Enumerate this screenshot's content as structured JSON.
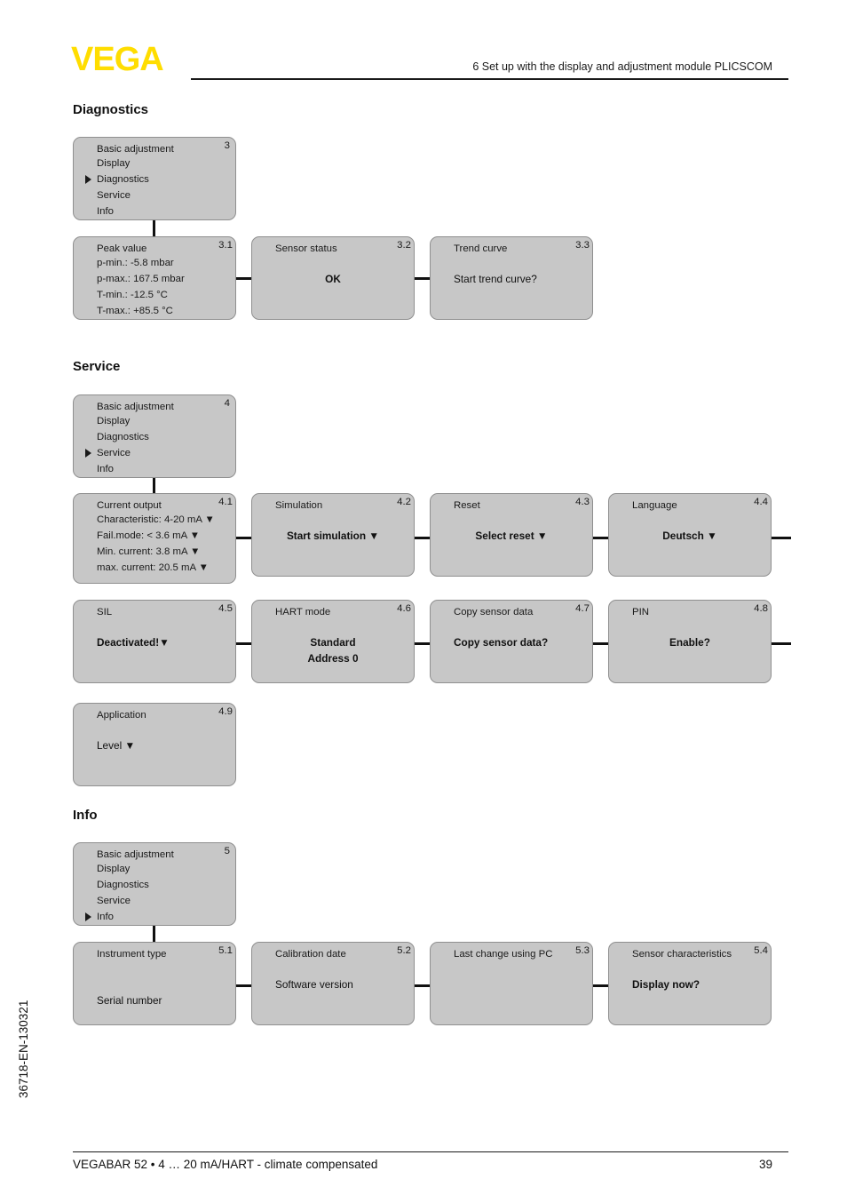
{
  "header": {
    "logo_text": "VEGA",
    "logo_color": "#FFDD00",
    "chapter_title": "6 Set up with the display and adjustment module PLICSCOM"
  },
  "footer": {
    "doc_code": "36718-EN-130321",
    "product_line": "VEGABAR 52 • 4 … 20 mA/HART - climate compensated",
    "page_number": "39"
  },
  "sections": [
    {
      "heading": "Diagnostics"
    },
    {
      "heading": "Service"
    },
    {
      "heading": "Info"
    }
  ],
  "diagnostics": {
    "menu": {
      "num": "3",
      "items": [
        {
          "label": "Basic adjustment",
          "selected": false
        },
        {
          "label": "Display",
          "selected": false
        },
        {
          "label": "Diagnostics",
          "selected": true
        },
        {
          "label": "Service",
          "selected": false
        },
        {
          "label": "Info",
          "selected": false
        }
      ]
    },
    "boxes": [
      {
        "num": "3.1",
        "title": "Peak value",
        "lines": [
          "p-min.: -5.8 mbar",
          "p-max.: 167.5 mbar",
          "T-min.: -12.5 °C",
          "T-max.: +85.5 °C"
        ]
      },
      {
        "num": "3.2",
        "title": "Sensor status",
        "value": "OK",
        "align": "center",
        "bold": true
      },
      {
        "num": "3.3",
        "title": "Trend curve",
        "value": "Start trend curve?",
        "align": "left",
        "bold": false
      }
    ]
  },
  "service": {
    "menu": {
      "num": "4",
      "items": [
        {
          "label": "Basic adjustment",
          "selected": false
        },
        {
          "label": "Display",
          "selected": false
        },
        {
          "label": "Diagnostics",
          "selected": false
        },
        {
          "label": "Service",
          "selected": true
        },
        {
          "label": "Info",
          "selected": false
        }
      ]
    },
    "boxes": [
      {
        "num": "4.1",
        "title": "Current output",
        "lines": [
          "Characteristic: 4-20 mA ▼",
          "Fail.mode: < 3.6 mA ▼",
          "Min. current: 3.8 mA ▼",
          "max. current: 20.5 mA ▼"
        ]
      },
      {
        "num": "4.2",
        "title": "Simulation",
        "value": "Start simulation ▼",
        "align": "center",
        "bold": true
      },
      {
        "num": "4.3",
        "title": "Reset",
        "value": "Select reset ▼",
        "align": "center",
        "bold": true
      },
      {
        "num": "4.4",
        "title": "Language",
        "value": "Deutsch ▼",
        "align": "center",
        "bold": true
      },
      {
        "num": "4.5",
        "title": "SIL",
        "value": "Deactivated!▼",
        "align": "left",
        "bold": true
      },
      {
        "num": "4.6",
        "title": "HART mode",
        "value": "Standard",
        "value2": "Address 0",
        "align": "center",
        "bold": true
      },
      {
        "num": "4.7",
        "title": "Copy sensor data",
        "value": "Copy sensor data?",
        "align": "left",
        "bold": true
      },
      {
        "num": "4.8",
        "title": "PIN",
        "value": "Enable?",
        "align": "center",
        "bold": true
      },
      {
        "num": "4.9",
        "title": "Application",
        "value": "Level ▼",
        "align": "left",
        "bold": false
      }
    ]
  },
  "info": {
    "menu": {
      "num": "5",
      "items": [
        {
          "label": "Basic adjustment",
          "selected": false
        },
        {
          "label": "Display",
          "selected": false
        },
        {
          "label": "Diagnostics",
          "selected": false
        },
        {
          "label": "Service",
          "selected": false
        },
        {
          "label": "Info",
          "selected": true
        }
      ]
    },
    "boxes": [
      {
        "num": "5.1",
        "title": "Instrument type",
        "value": "Serial number",
        "align": "left",
        "bold": false,
        "offset": 2
      },
      {
        "num": "5.2",
        "title": "Calibration date",
        "value": "Software version",
        "align": "left",
        "bold": false
      },
      {
        "num": "5.3",
        "title": "Last change using PC",
        "value": "",
        "align": "left",
        "bold": false
      },
      {
        "num": "5.4",
        "title": "Sensor characteristics",
        "value": "Display now?",
        "align": "left",
        "bold": true
      }
    ]
  }
}
